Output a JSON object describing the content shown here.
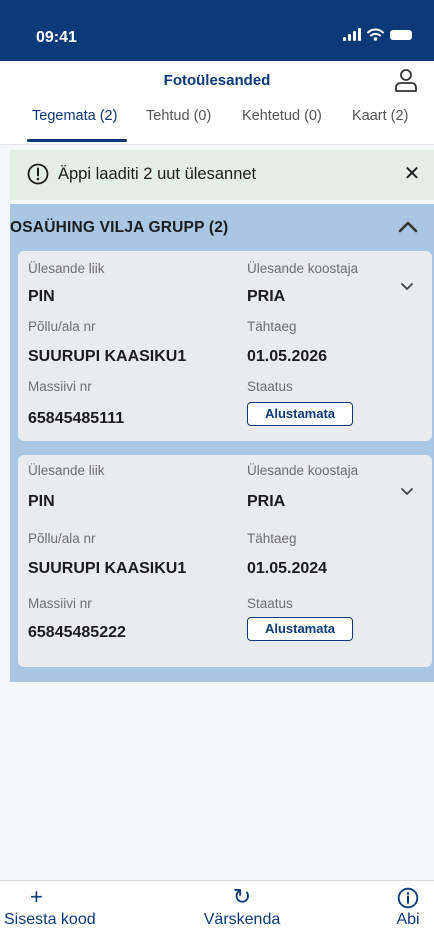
{
  "status_bar": {
    "time": "09:41",
    "icons": [
      "signal-icon",
      "wifi-icon",
      "battery-icon"
    ]
  },
  "header": {
    "title": "Fotoülesanded",
    "profile_icon": "profile-icon"
  },
  "tabs": [
    {
      "label": "Tegemata (2)",
      "active": true
    },
    {
      "label": "Tehtud (0)",
      "active": false
    },
    {
      "label": "Kehtetud (0)",
      "active": false
    },
    {
      "label": "Kaart (2)",
      "active": false
    }
  ],
  "banner": {
    "text": "Äppi laaditi 2 uut ülesannet",
    "icon": "info-icon",
    "close": "✕"
  },
  "group": {
    "title": "OSAÜHING VILJA GRUPP (2)",
    "tasks": [
      {
        "type_label": "Ülesande liik",
        "type_value": "PIN",
        "author_label": "Ülesande koostaja",
        "author_value": "PRIA",
        "field_label": "Põllu/ala nr",
        "field_value": "SUURUPI KAASIKU1",
        "deadline_label": "Tähtaeg",
        "deadline_value": "01.05.2026",
        "massif_label": "Massiivi nr",
        "massif_value": "65845485111",
        "status_label": "Staatus",
        "status_value": "Alustamata"
      },
      {
        "type_label": "Ülesande liik",
        "type_value": "PIN",
        "author_label": "Ülesande koostaja",
        "author_value": "PRIA",
        "field_label": "Põllu/ala nr",
        "field_value": "SUURUPI KAASIKU1",
        "deadline_label": "Tähtaeg",
        "deadline_value": "01.05.2024",
        "massif_label": "Massiivi nr",
        "massif_value": "65845485222",
        "status_label": "Staatus",
        "status_value": "Alustamata"
      }
    ]
  },
  "bottom_nav": [
    {
      "label": "Sisesta kood",
      "icon": "+"
    },
    {
      "label": "Värskenda",
      "icon": "↻"
    },
    {
      "label": "Abi",
      "icon": "info-icon"
    }
  ],
  "colors": {
    "primary": "#0c3a78",
    "group_bg": "#a9c6e2",
    "banner_bg": "#e3efe6",
    "card_bg": "#e9ebee"
  }
}
